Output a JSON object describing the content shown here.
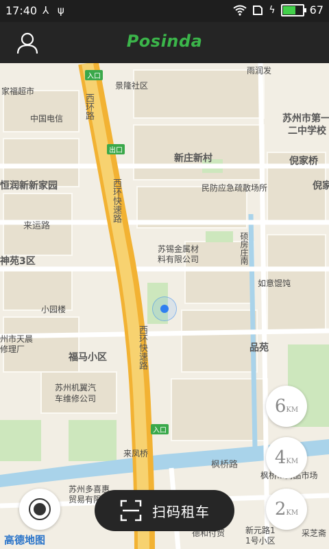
{
  "status_bar": {
    "time": "17:40",
    "battery": "67",
    "battery_fraction": 0.67
  },
  "header": {
    "logo": "Posinda"
  },
  "map": {
    "labels": {
      "ruirunfa": "雨润发",
      "jinglong": "景隆社区",
      "jiajiafu": "家福超市",
      "china_telecom": "中国电信",
      "xinzhuang": "新庄新村",
      "suzhou_school": "苏州市第一",
      "suzhou_school2": "二中学校",
      "nijiaqiao": "倪家桥",
      "hengrun": "恒润新新家园",
      "minfang": "民防应急疏散场所",
      "laiyun": "来运路",
      "jinshu": "苏锡金属材",
      "jinshu2": "料有限公司",
      "shenyuan": "神苑3区",
      "ruyi": "如意馄饨",
      "xiaoyuanlou": "小园楼",
      "tianchen": "州市天晨",
      "tianchen2": "修理厂",
      "fuma": "福马小区",
      "pinyuan": "品苑",
      "jiyi": "苏州机翼汽",
      "jiyi2": "车维修公司",
      "laifengqiao": "来凤桥",
      "fengqiao": "枫桥路",
      "fengqiao_market": "枫桥...商品市场",
      "duoxi": "苏州多喜惠",
      "duoxi2": "贸易有限公",
      "xinyuan": "新元路1",
      "xinyuan2": "1号小区",
      "xihuan": "西环路",
      "xihuan_expr": "西环快速路",
      "xihuan_expr2": "西环快速路",
      "suofang": "硕房庄南",
      "ni2": "倪家",
      "fa": "发",
      "dehe": "德和付贸",
      "caizhi": "采芝斋",
      "rukou": "入口",
      "chukou": "出口",
      "rukou2": "入口"
    },
    "watermark": "高德地图"
  },
  "distance_buttons": [
    {
      "num": "6",
      "unit": "KM"
    },
    {
      "num": "4",
      "unit": "KM"
    },
    {
      "num": "2",
      "unit": "KM"
    }
  ],
  "scan_button": {
    "label": "扫码租车"
  },
  "icons": {
    "user": "user-icon",
    "locate": "locate-icon",
    "scan": "scan-icon"
  }
}
